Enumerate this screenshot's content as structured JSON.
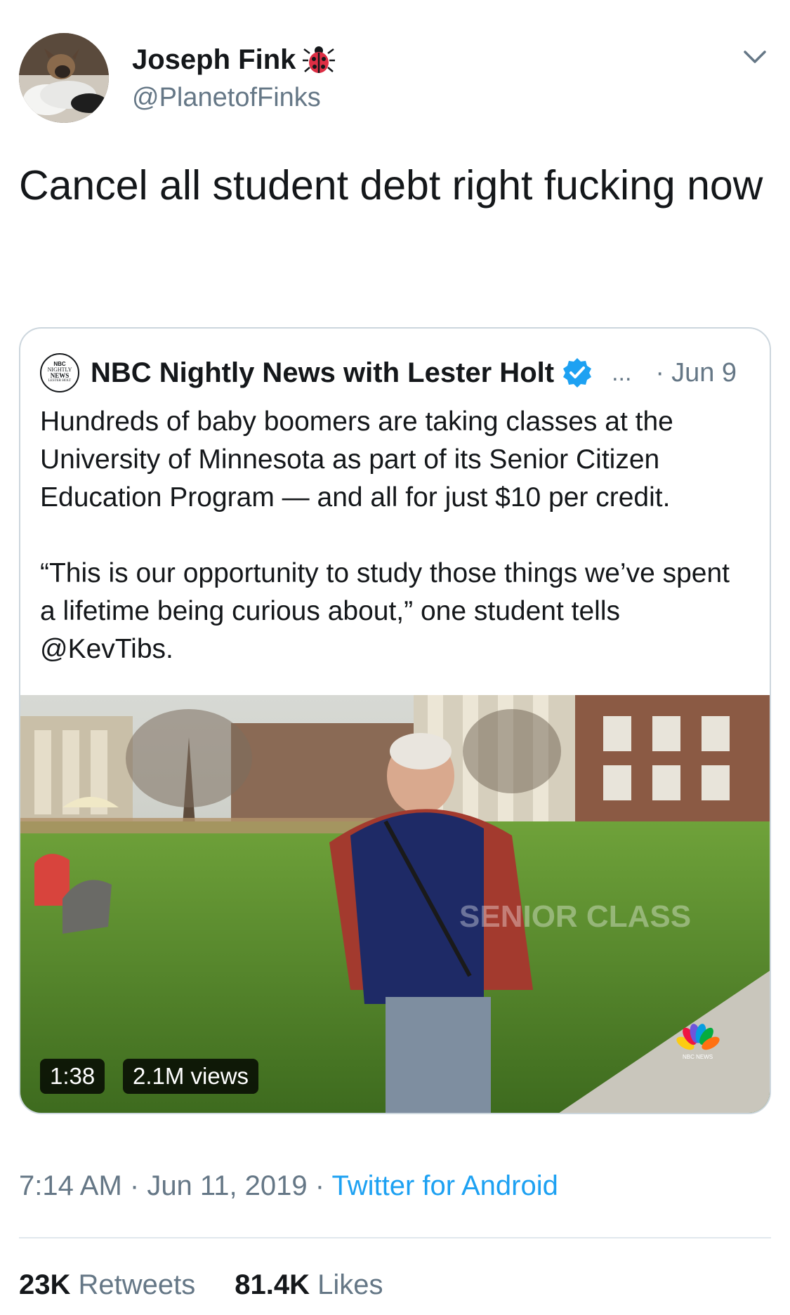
{
  "author": {
    "display_name": "Joseph Fink",
    "handle": "@PlanetofFinks",
    "avatar_icon": "dog-avatar",
    "badge_icon": "ladybug-icon"
  },
  "tweet": {
    "text": "Cancel all student debt right fucking now"
  },
  "quote": {
    "display_name": "NBC Nightly News with Lester Holt",
    "logo_lines": [
      "NBC",
      "NIGHTLY",
      "NEWS",
      "LESTER HOLT"
    ],
    "verified_icon": "verified-badge-icon",
    "ellipsis": "...",
    "separator": "·",
    "date": "Jun 9",
    "paragraphs": [
      "Hundreds of baby boomers are taking classes at the University of Minnesota as part of its Senior Citizen Education Program — and all for just $10 per credit.",
      "“This is our opportunity to study those things we’ve spent a lifetime being curious about,” one student tells @KevTibs."
    ],
    "video": {
      "duration": "1:38",
      "views": "2.1M views",
      "watermark": "NBC NEWS",
      "overlay_text": "SENIOR CLASS"
    }
  },
  "meta": {
    "time": "7:14 AM",
    "sep1": " · ",
    "date": "Jun 11, 2019",
    "sep2": " · ",
    "source": "Twitter for Android"
  },
  "stats": {
    "retweets_count": "23K",
    "retweets_label": "Retweets",
    "likes_count": "81.4K",
    "likes_label": "Likes"
  },
  "colors": {
    "link": "#1da1f2",
    "secondary_text": "#657786",
    "verified": "#1da1f2",
    "border": "#ccd6dd"
  }
}
